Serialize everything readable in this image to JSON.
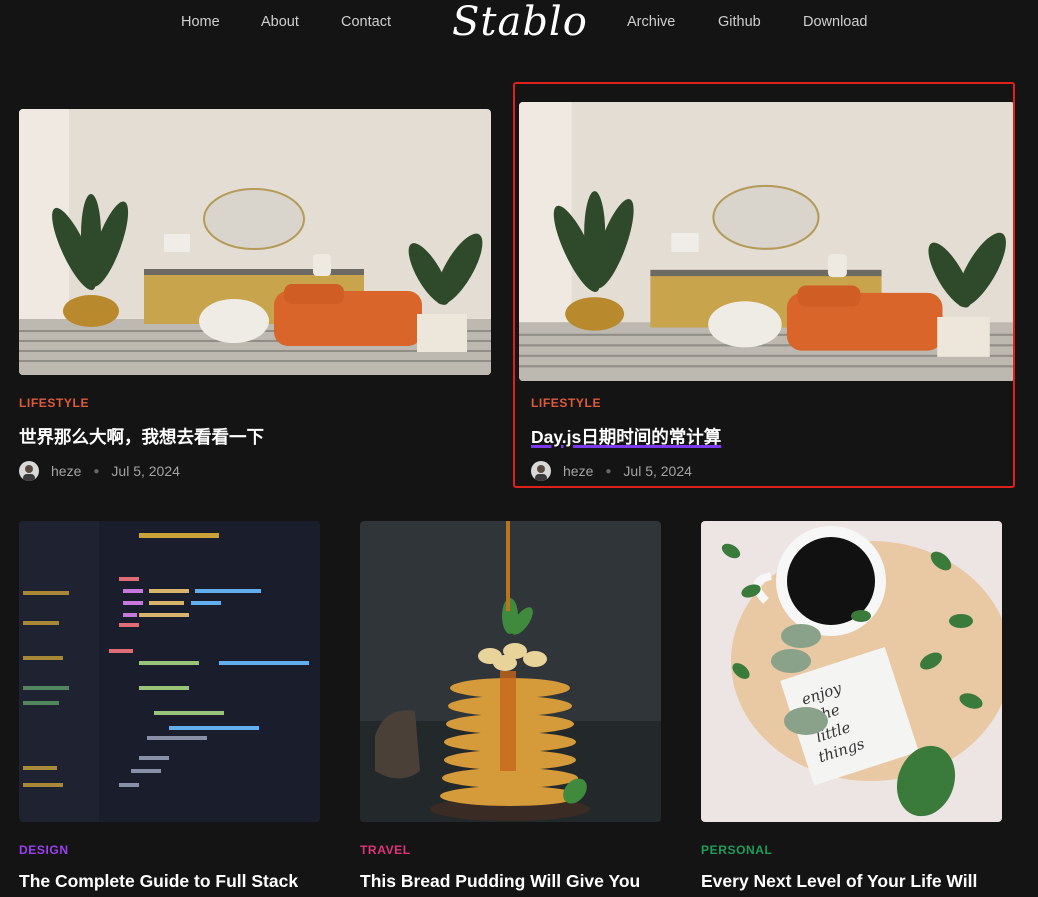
{
  "nav": {
    "left": [
      "Home",
      "About",
      "Contact"
    ],
    "logo": "Stablo",
    "right": [
      "Archive",
      "Github",
      "Download"
    ]
  },
  "posts": [
    {
      "category": "LIFESTYLE",
      "category_color": "#e05a3a",
      "title": "世界那么大啊，我想去看看一下",
      "author": "heze",
      "date": "Jul 5, 2024",
      "image": "living-room-photo"
    },
    {
      "category": "LIFESTYLE",
      "category_color": "#e05a3a",
      "title": "Day.js日期时间的常计算",
      "author": "heze",
      "date": "Jul 5, 2024",
      "image": "living-room-photo"
    },
    {
      "category": "DESIGN",
      "category_color": "#9b3ff0",
      "title": "The Complete Guide to Full Stack",
      "image": "code-editor-photo"
    },
    {
      "category": "TRAVEL",
      "category_color": "#e0337a",
      "title": "This Bread Pudding Will Give You",
      "image": "pancake-stack-photo"
    },
    {
      "category": "PERSONAL",
      "category_color": "#1f9d5c",
      "title": "Every Next Level of Your Life Will",
      "image": "coffee-macaron-photo"
    }
  ],
  "images": {
    "code_editor_text": "enjoy the little things"
  }
}
